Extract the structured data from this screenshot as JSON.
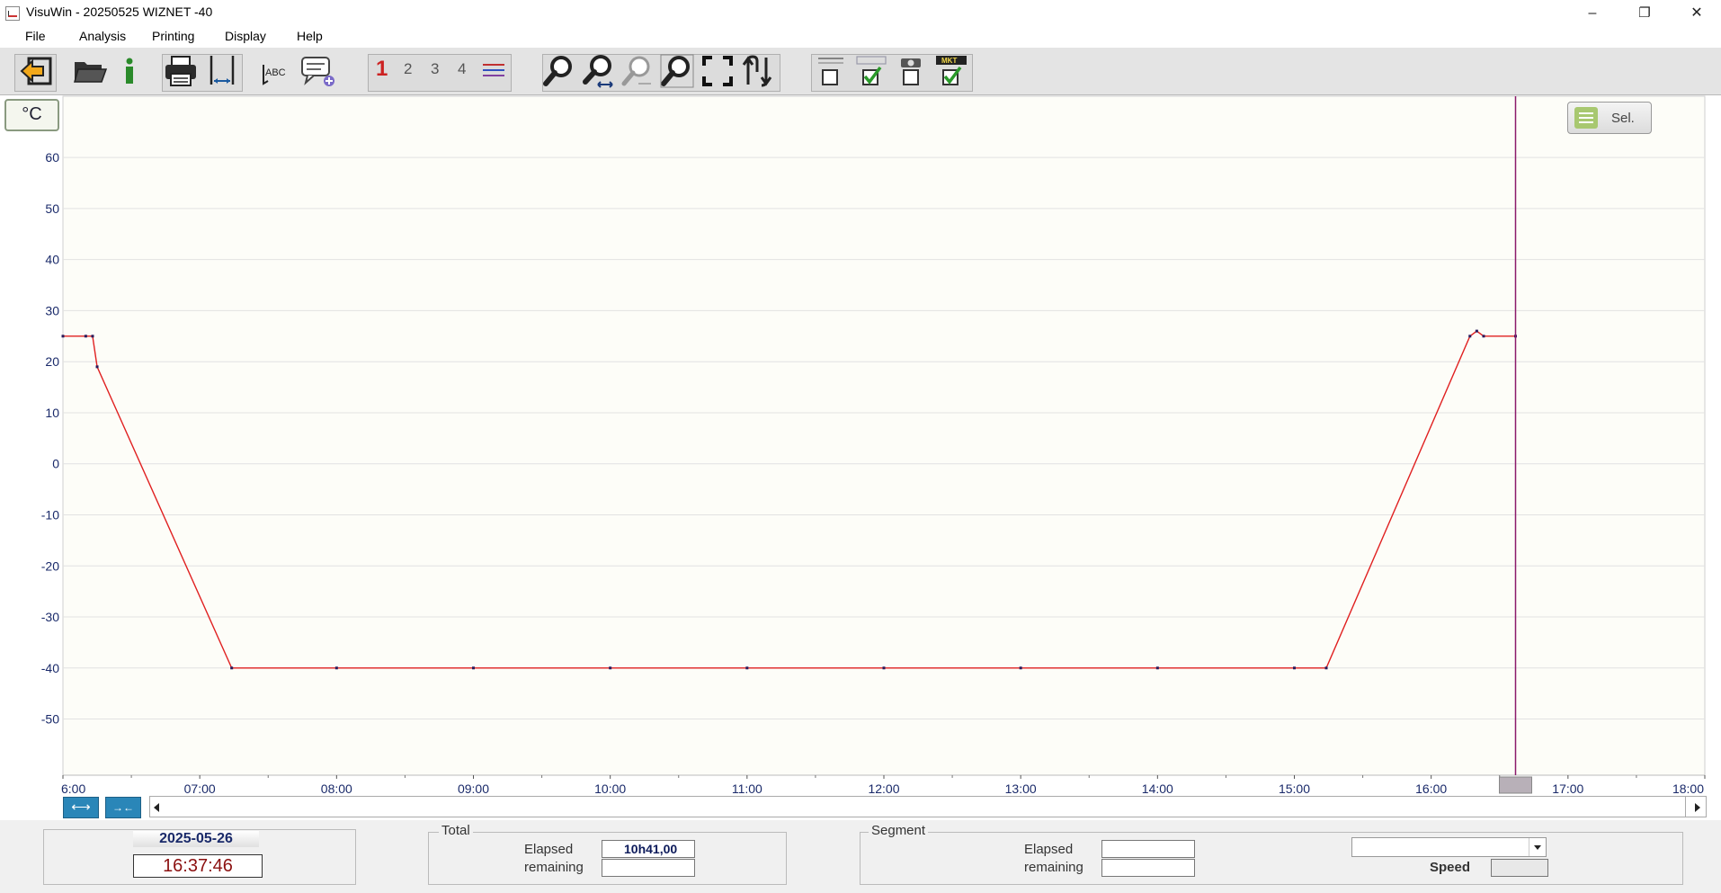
{
  "window": {
    "title": "VisuWin - 20250525 WIZNET -40",
    "minimize_glyph": "–",
    "restore_glyph": "❐",
    "close_glyph": "✕"
  },
  "menu": [
    "File",
    "Analysis",
    "Printing",
    "Display",
    "Help"
  ],
  "toolbar": {
    "icons": [
      "exit-icon",
      "open-folder-icon",
      "info-icon",
      "print-icon",
      "page-width-icon",
      "spellcheck-icon",
      "comment-add-icon",
      "zoom-icon",
      "zoom-horizontal-icon",
      "zoom-out-icon",
      "zoom-fit-icon",
      "fullscreen-icon",
      "swap-axes-icon",
      "hide-legend-icon",
      "show-legend-icon",
      "camera-icon",
      "mkt-icon"
    ],
    "channel_numbers": [
      "1",
      "2",
      "3",
      "4"
    ],
    "spellcheck_text": "ABC",
    "mkt_text": "MKT",
    "colors": {
      "active_channel": "#cc2222",
      "inactive_channel": "#555555",
      "zoom_blue": "#1a3a7a"
    }
  },
  "chart": {
    "unit_label": "°C",
    "select_label": "Sel.",
    "cursor_color": "#8b1a6b",
    "line_color": "#e02020"
  },
  "chart_data": {
    "type": "line",
    "title": "",
    "xlabel": "",
    "ylabel": "°C",
    "x_tick_labels": [
      "6:00",
      "07:00",
      "08:00",
      "09:00",
      "10:00",
      "11:00",
      "12:00",
      "13:00",
      "14:00",
      "15:00",
      "16:00",
      "17:00",
      "18:00"
    ],
    "y_tick_labels": [
      "60",
      "50",
      "40",
      "30",
      "20",
      "10",
      "0",
      "-10",
      "-20",
      "-30",
      "-40",
      "-50"
    ],
    "xlim": [
      "06:00",
      "18:00"
    ],
    "ylim": [
      -61,
      72
    ],
    "grid": true,
    "cursor_time": "16:37",
    "series": [
      {
        "color": "#e02020",
        "x": [
          "06:00",
          "06:10",
          "06:13",
          "06:15",
          "07:14",
          "08:00",
          "09:00",
          "10:00",
          "11:00",
          "12:00",
          "13:00",
          "14:00",
          "15:00",
          "15:14",
          "16:17",
          "16:20",
          "16:23",
          "16:37"
        ],
        "y": [
          25,
          25,
          25,
          19,
          -40,
          -40,
          -40,
          -40,
          -40,
          -40,
          -40,
          -40,
          -40,
          -40,
          25,
          26,
          25,
          25
        ]
      }
    ]
  },
  "timeline": {
    "expand_icon": "⟷",
    "collapse_icon": "→←"
  },
  "status": {
    "date": "2025-05-26",
    "time": "16:37:46",
    "total_title": "Total",
    "segment_title": "Segment",
    "elapsed_label": "Elapsed",
    "remaining_label": "remaining",
    "total_elapsed": "10h41,00",
    "total_remaining": "",
    "segment_elapsed": "",
    "segment_remaining": "",
    "speed_label": "Speed",
    "speed_value": ""
  }
}
